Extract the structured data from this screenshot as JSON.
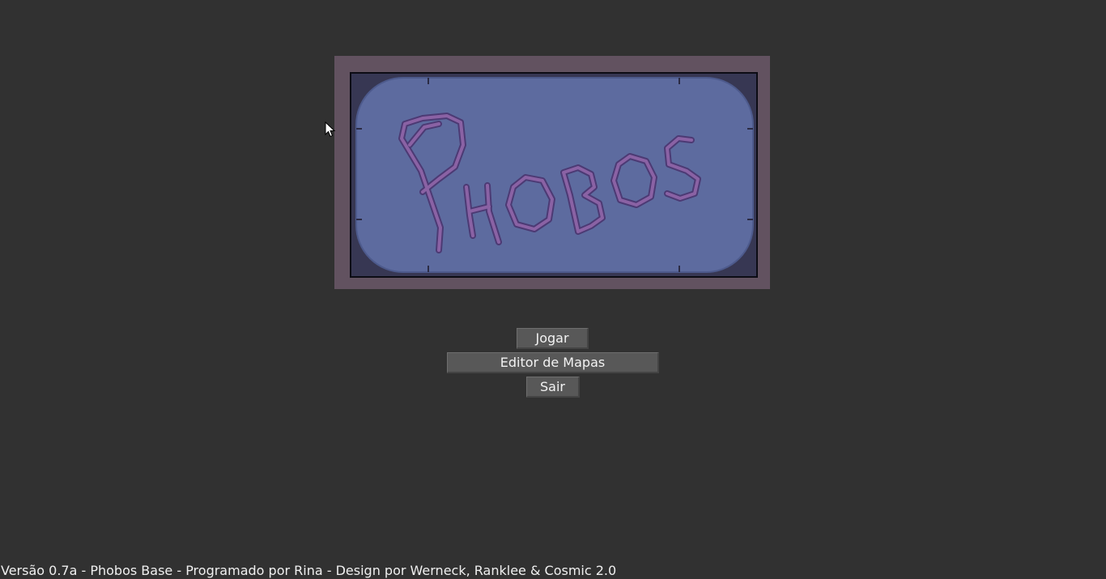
{
  "logo": {
    "text": "Phobos",
    "colors": {
      "frame": "#625260",
      "panel_border": "#373753",
      "panel_fill": "#5d6b9f",
      "lettering": "#8a62a4",
      "lettering_outline": "#4c3a74"
    }
  },
  "menu": {
    "play_label": "Jogar",
    "editor_label": "Editor de Mapas",
    "exit_label": "Sair"
  },
  "footer": {
    "text": "Versão 0.7a - Phobos Base - Programado por Rina - Design por Werneck, Ranklee & Cosmic 2.0"
  },
  "colors": {
    "background": "#313131",
    "button": "#585858",
    "text": "#f2f2f2"
  },
  "icons": {
    "cursor": "mouse-pointer-icon"
  }
}
